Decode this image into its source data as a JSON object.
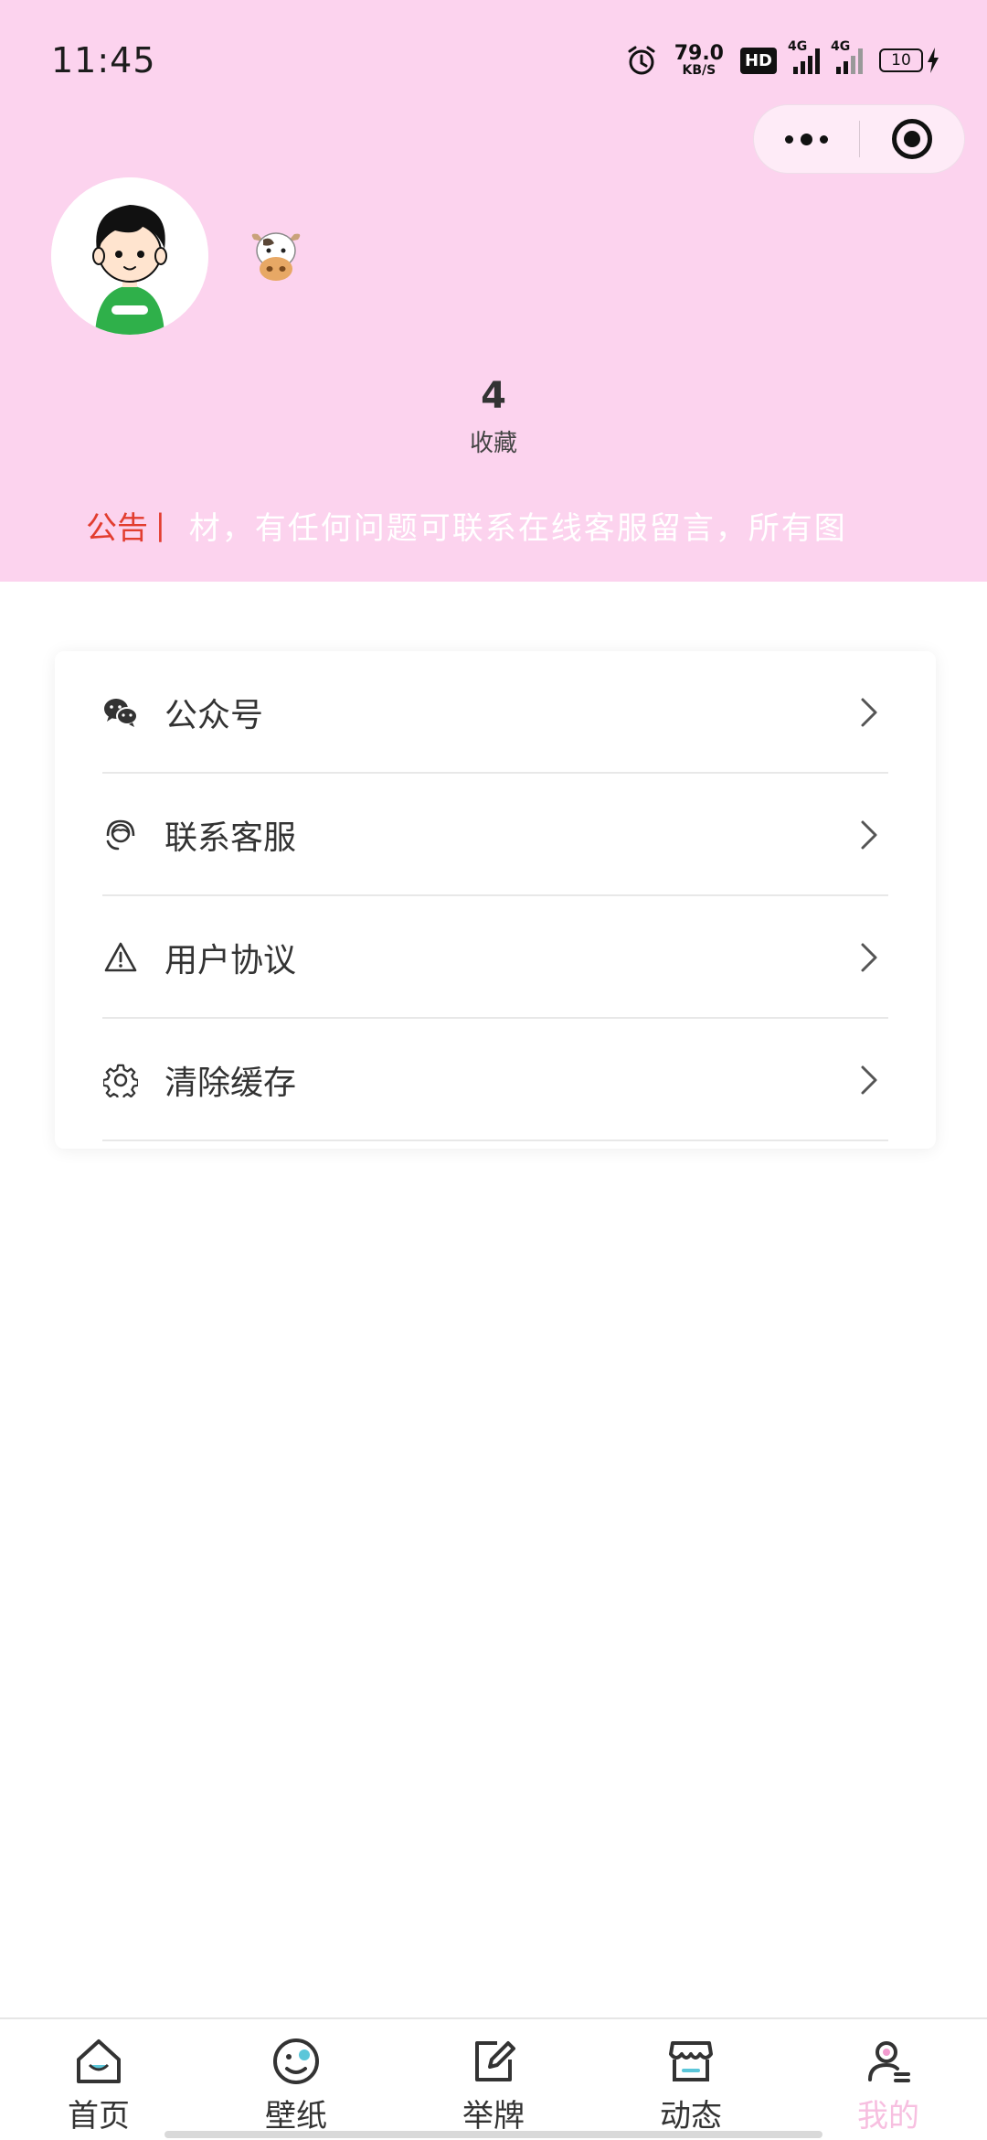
{
  "status_bar": {
    "time": "11:45",
    "net_speed_value": "79.0",
    "net_speed_unit": "KB/S",
    "hd_badge": "HD",
    "signal_1_label": "4G",
    "signal_2_label": "4G",
    "battery_level": "10",
    "icons": [
      "alarm-icon",
      "hd-icon",
      "signal-icon",
      "battery-charging-icon"
    ]
  },
  "capsule": {
    "more_icon": "more-dots-icon",
    "close_icon": "target-close-icon"
  },
  "profile": {
    "avatar": "cartoon-boy-avatar",
    "nickname_emoji": "cow-face-emoji"
  },
  "stats": {
    "favorites_count": "4",
    "favorites_label": "收藏"
  },
  "notice": {
    "tag": "公告",
    "separator": "|",
    "text": "材，有任何问题可联系在线客服留言，所有图"
  },
  "menu": {
    "items": [
      {
        "label": "公众号",
        "icon": "wechat-icon"
      },
      {
        "label": "联系客服",
        "icon": "headset-icon"
      },
      {
        "label": "用户协议",
        "icon": "warning-icon"
      },
      {
        "label": "清除缓存",
        "icon": "gear-icon"
      }
    ]
  },
  "tabbar": {
    "tabs": [
      {
        "label": "首页",
        "icon": "home-icon"
      },
      {
        "label": "壁纸",
        "icon": "wallpaper-face-icon"
      },
      {
        "label": "举牌",
        "icon": "edit-icon"
      },
      {
        "label": "动态",
        "icon": "store-icon"
      },
      {
        "label": "我的",
        "icon": "user-icon",
        "active": true
      }
    ]
  },
  "colors": {
    "header_bg": "#fcd3ee",
    "notice_tag": "#e23d2f",
    "active_tab": "#f7bfe0"
  }
}
